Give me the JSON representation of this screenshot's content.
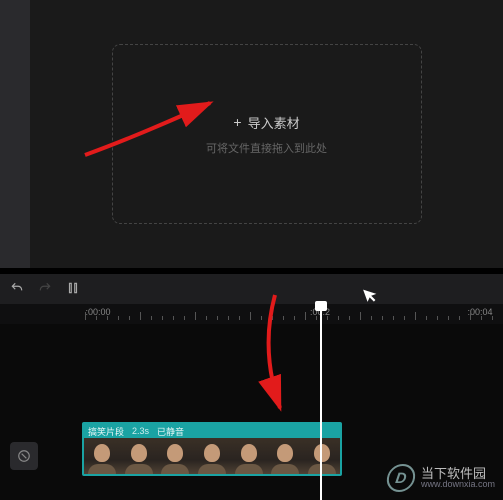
{
  "import": {
    "label": "导入素材",
    "hint": "可将文件直接拖入到此处"
  },
  "toolbar": {
    "undo": "↶",
    "redo": "↷",
    "split": "】【"
  },
  "ruler": {
    "t0": ":00:00",
    "t2": ":00:2",
    "t4": ":00:04"
  },
  "clip": {
    "name": "搞笑片段",
    "duration": "2.3s",
    "mute": "已静音"
  },
  "watermark": {
    "logo": "D",
    "cn": "当下软件园",
    "en": "www.downxia.com"
  }
}
